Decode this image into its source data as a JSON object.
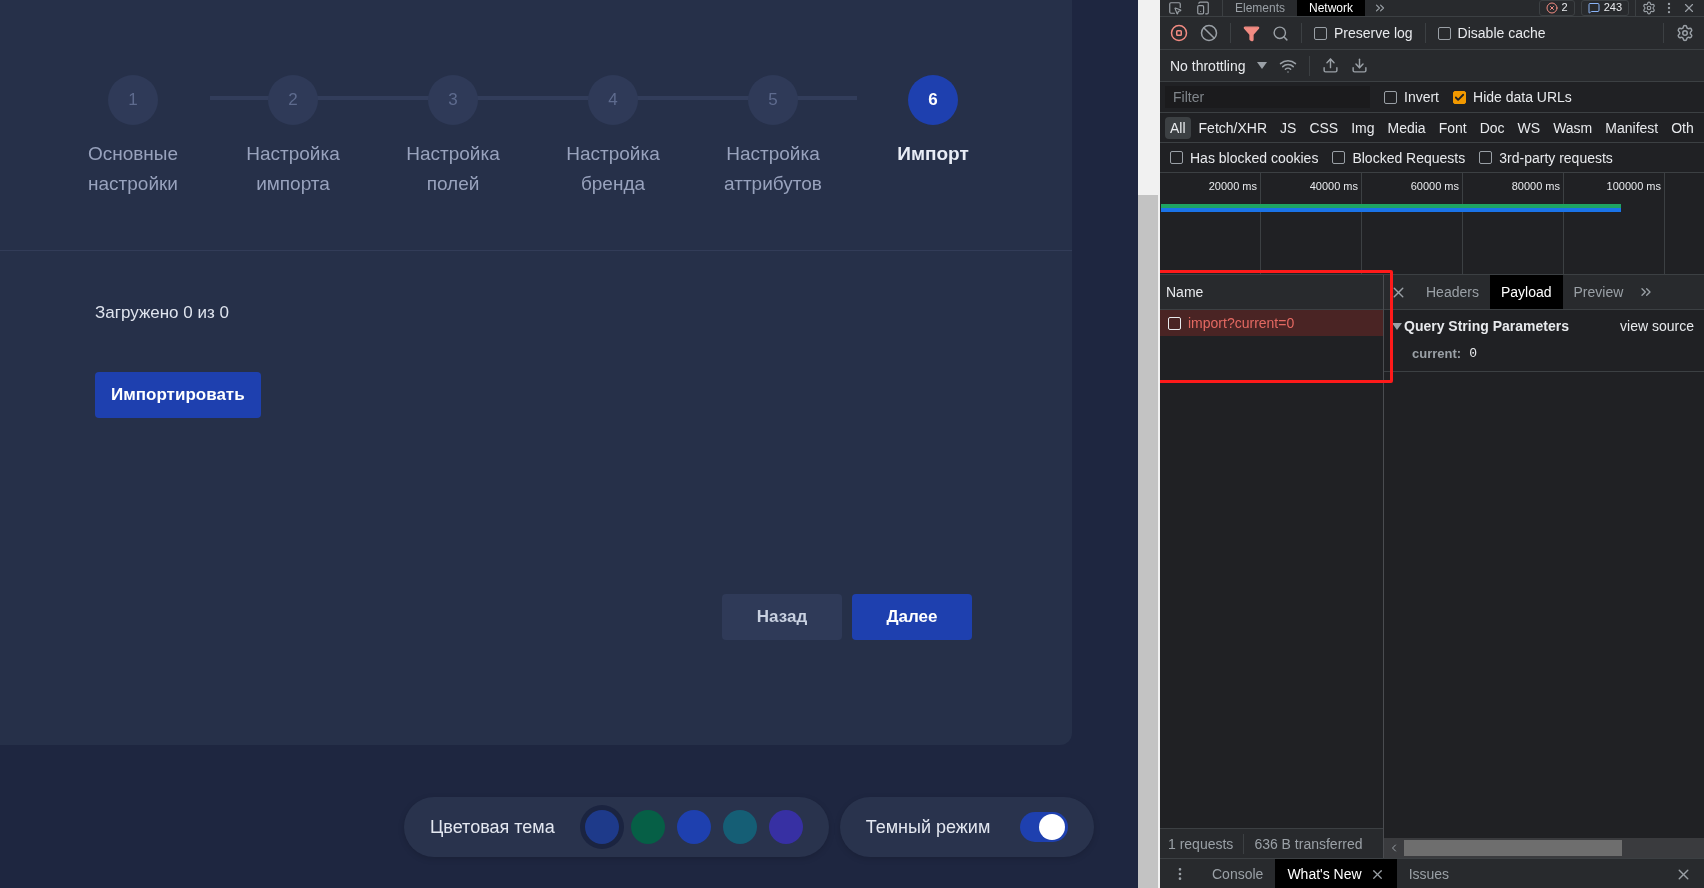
{
  "stepper": {
    "steps": [
      {
        "number": "1",
        "label": "Основные настройки",
        "selected": false
      },
      {
        "number": "2",
        "label": "Настройка импорта",
        "selected": false
      },
      {
        "number": "3",
        "label": "Настройка полей",
        "selected": false
      },
      {
        "number": "4",
        "label": "Настройка бренда",
        "selected": false
      },
      {
        "number": "5",
        "label": "Настройка аттрибутов",
        "selected": false
      },
      {
        "number": "6",
        "label": "Импорт",
        "selected": true
      }
    ]
  },
  "import_panel": {
    "status": "Загружено 0 из 0",
    "import_button": "Импортировать"
  },
  "navigation": {
    "back": "Назад",
    "next": "Далее"
  },
  "theme_bar": {
    "color_label": "Цветовая тема",
    "swatches": [
      {
        "color": "#1e3a8a",
        "selected": true
      },
      {
        "color": "#065f46",
        "selected": false
      },
      {
        "color": "#1e40af",
        "selected": false
      },
      {
        "color": "#155e75",
        "selected": false
      },
      {
        "color": "#3730a3",
        "selected": false
      }
    ],
    "dark_mode_label": "Темный режим",
    "dark_mode_on": true
  },
  "devtools": {
    "panel_tabs": [
      {
        "label": "Elements",
        "selected": false
      },
      {
        "label": "Network",
        "selected": true
      }
    ],
    "error_count": "2",
    "message_count": "243",
    "preserve_log": {
      "label": "Preserve log",
      "checked": false
    },
    "disable_cache": {
      "label": "Disable cache",
      "checked": false
    },
    "throttling": "No throttling",
    "filter": {
      "placeholder": "Filter"
    },
    "invert": {
      "label": "Invert",
      "checked": false
    },
    "hide_data_urls": {
      "label": "Hide data URLs",
      "checked": true
    },
    "type_filters": [
      {
        "label": "All",
        "selected": true
      },
      {
        "label": "Fetch/XHR",
        "selected": false
      },
      {
        "label": "JS",
        "selected": false
      },
      {
        "label": "CSS",
        "selected": false
      },
      {
        "label": "Img",
        "selected": false
      },
      {
        "label": "Media",
        "selected": false
      },
      {
        "label": "Font",
        "selected": false
      },
      {
        "label": "Doc",
        "selected": false
      },
      {
        "label": "WS",
        "selected": false
      },
      {
        "label": "Wasm",
        "selected": false
      },
      {
        "label": "Manifest",
        "selected": false
      },
      {
        "label": "Oth",
        "selected": false
      }
    ],
    "extra_filters": [
      {
        "label": "Has blocked cookies",
        "checked": false
      },
      {
        "label": "Blocked Requests",
        "checked": false
      },
      {
        "label": "3rd-party requests",
        "checked": false
      }
    ],
    "timeline": {
      "ticks": [
        "20000 ms",
        "40000 ms",
        "60000 ms",
        "80000 ms",
        "100000 ms"
      ]
    },
    "requests": {
      "column": "Name",
      "rows": [
        {
          "name": "import?current=0",
          "failed": true,
          "selected": true,
          "checked": false
        }
      ]
    },
    "detail_tabs": [
      {
        "label": "Headers",
        "selected": false
      },
      {
        "label": "Payload",
        "selected": true
      },
      {
        "label": "Preview",
        "selected": false
      }
    ],
    "payload": {
      "section": "Query String Parameters",
      "expanded": true,
      "view_source": "view source",
      "params": [
        {
          "key": "current:",
          "value": "0"
        }
      ]
    },
    "summary": [
      "1 requests",
      "636 B transferred"
    ],
    "drawer_tabs": [
      {
        "label": "Console",
        "selected": false,
        "closable": false
      },
      {
        "label": "What's New",
        "selected": true,
        "closable": true
      },
      {
        "label": "Issues",
        "selected": false,
        "closable": false
      }
    ]
  }
}
